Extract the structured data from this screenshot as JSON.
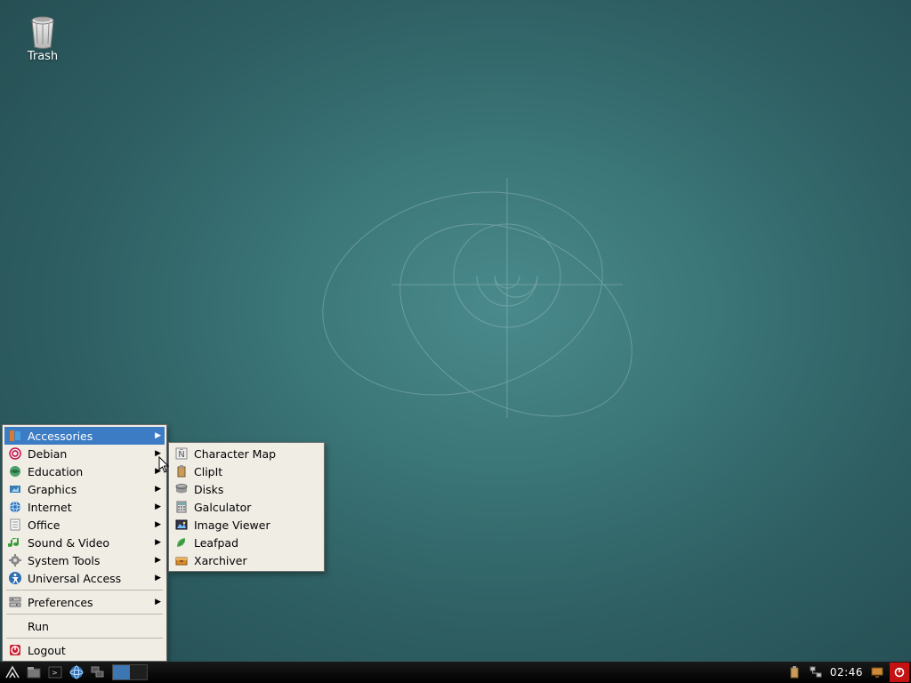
{
  "desktop": {
    "trash_label": "Trash"
  },
  "menu": {
    "items": [
      {
        "label": "Accessories",
        "icon": "accessories-icon",
        "submenu": true,
        "highlight": true
      },
      {
        "label": "Debian",
        "icon": "debian-icon",
        "submenu": true
      },
      {
        "label": "Education",
        "icon": "education-icon",
        "submenu": true
      },
      {
        "label": "Graphics",
        "icon": "graphics-icon",
        "submenu": true
      },
      {
        "label": "Internet",
        "icon": "internet-icon",
        "submenu": true
      },
      {
        "label": "Office",
        "icon": "office-icon",
        "submenu": true
      },
      {
        "label": "Sound & Video",
        "icon": "media-icon",
        "submenu": true
      },
      {
        "label": "System Tools",
        "icon": "systemtools-icon",
        "submenu": true
      },
      {
        "label": "Universal Access",
        "icon": "universalaccess-icon",
        "submenu": true
      }
    ],
    "preferences_label": "Preferences",
    "run_label": "Run",
    "logout_label": "Logout"
  },
  "submenu": {
    "items": [
      {
        "label": "Character Map",
        "icon": "charactermap-icon"
      },
      {
        "label": "ClipIt",
        "icon": "clipit-icon"
      },
      {
        "label": "Disks",
        "icon": "disks-icon"
      },
      {
        "label": "Galculator",
        "icon": "calculator-icon"
      },
      {
        "label": "Image Viewer",
        "icon": "imageviewer-icon"
      },
      {
        "label": "Leafpad",
        "icon": "leafpad-icon"
      },
      {
        "label": "Xarchiver",
        "icon": "archiver-icon"
      }
    ]
  },
  "taskbar": {
    "clock": "02:46"
  }
}
